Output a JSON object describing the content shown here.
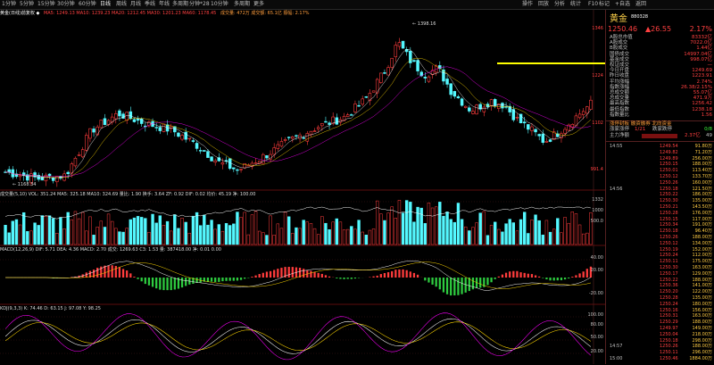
{
  "toolbar": {
    "tabs": [
      "1分钟",
      "5分钟",
      "15分钟",
      "30分钟",
      "60分钟",
      "日线",
      "周线",
      "月线",
      "季线",
      "年线",
      "多周期",
      "分钟*28",
      "10分钟",
      "多周期",
      "更多"
    ],
    "active_tab": "日线",
    "right_items": [
      "操作",
      "回放",
      "分析",
      "统计",
      "F10",
      "标记",
      "+自选",
      "返回"
    ]
  },
  "info": {
    "main": "黄金(日线)前复权 ◆",
    "main_ma": "MA5: 1249.13  MA10: 1239.23  MA20: 1212.45  MA30: 1201.23  MA60: 1178.45",
    "main_extra": "成交量: 472万  成交额: 65.1亿  振幅: 2.17%",
    "vol": "成交量(5,10)  VOL: 351.24  MA5: 325.18  MA10: 324.69  量比: 1.90  换手: 3.64  ZF: 0.92  DIF: 0.02  均价: 45.19  净: 100.00",
    "macd": "MACD(12,26,9)  DIF: 5.71  DEA: 4.36  MACD: 2.70  成交: 1269.63  C3: 1.53  量: 387418.00  净: 0.01  0.00",
    "kdj": "KDJ(9,3,3)  K: 74.46  D: 63.15  J: 97.08  Y: 98.25"
  },
  "price_axis": [
    "1346",
    "1224",
    "1102",
    "991.4"
  ],
  "vol_axis": [
    "1332",
    "1000",
    "500.0"
  ],
  "macd_axis": [
    "40.00",
    "20.00",
    "-20.00"
  ],
  "kdj_axis": [
    "100.00",
    "80.00",
    "50.00",
    "20.00"
  ],
  "annotations": {
    "high": "1398.16",
    "low": "1168.34"
  },
  "sidebar": {
    "title": "黄金",
    "code": "880328",
    "price": "1250.46",
    "change": "▲26.55",
    "change_pct": "2.17%",
    "rows": [
      {
        "label": "A股总市值",
        "value": "83332亿"
      },
      {
        "label": "A股成交",
        "value": "7022.0亿"
      },
      {
        "label": "B股成交",
        "value": "1.44亿"
      },
      {
        "label": "国债成交",
        "value": "14997.04亿"
      },
      {
        "label": "基金成交",
        "value": "998.07亿"
      },
      {
        "label": "权证成交",
        "value": "—"
      },
      {
        "label": "今日开盘",
        "value": "1249.69"
      },
      {
        "label": "昨日收盘",
        "value": "1223.91"
      },
      {
        "label": "平均涨幅",
        "value": "2.74%"
      },
      {
        "label": "指数涨幅",
        "value": "26.38/2.15%"
      },
      {
        "label": "总成交额",
        "value": "55.07亿"
      },
      {
        "label": "总成交量",
        "value": "471.9万"
      },
      {
        "label": "最高指数",
        "value": "1256.42"
      },
      {
        "label": "最低指数",
        "value": "1238.18"
      },
      {
        "label": "指数量比",
        "value": "1.56"
      }
    ],
    "flow_header": "涨停封板  融资融券  北向资金",
    "flow_row1": [
      "涨家涨停",
      "1/21",
      "跌家跌停",
      "0/8"
    ],
    "flow_row2": [
      "主力净额",
      "2.37亿",
      "49"
    ],
    "ticks": [
      {
        "time": "14:55",
        "price": "1249.54",
        "vol": "91.80万"
      },
      {
        "time": "",
        "price": "1249.82",
        "vol": "71.20万"
      },
      {
        "time": "",
        "price": "1249.89",
        "vol": "256.00万"
      },
      {
        "time": "",
        "price": "1250.15",
        "vol": "188.00万"
      },
      {
        "time": "",
        "price": "1250.01",
        "vol": "113.40万"
      },
      {
        "time": "",
        "price": "1250.12",
        "vol": "133.70万"
      },
      {
        "time": "",
        "price": "1250.26",
        "vol": "160.00万"
      },
      {
        "time": "14:56",
        "price": "1250.18",
        "vol": "121.50万"
      },
      {
        "time": "",
        "price": "1250.22",
        "vol": "186.00万"
      },
      {
        "time": "",
        "price": "1250.30",
        "vol": "135.00万"
      },
      {
        "time": "",
        "price": "1250.21",
        "vol": "143.50万"
      },
      {
        "time": "",
        "price": "1250.28",
        "vol": "176.00万"
      },
      {
        "time": "",
        "price": "1250.15",
        "vol": "117.00万"
      },
      {
        "time": "",
        "price": "1250.34",
        "vol": "191.00万"
      },
      {
        "time": "",
        "price": "1250.18",
        "vol": "96.40万"
      },
      {
        "time": "",
        "price": "1250.26",
        "vol": "188.00万"
      },
      {
        "time": "",
        "price": "1250.12",
        "vol": "134.00万"
      },
      {
        "time": "",
        "price": "1250.19",
        "vol": "152.00万"
      },
      {
        "time": "",
        "price": "1250.24",
        "vol": "112.00万"
      },
      {
        "time": "",
        "price": "1250.11",
        "vol": "175.00万"
      },
      {
        "time": "",
        "price": "1250.30",
        "vol": "163.00万"
      },
      {
        "time": "",
        "price": "1250.17",
        "vol": "129.00万"
      },
      {
        "time": "",
        "price": "1250.22",
        "vol": "188.00万"
      },
      {
        "time": "",
        "price": "1250.36",
        "vol": "141.00万"
      },
      {
        "time": "",
        "price": "1250.20",
        "vol": "122.00万"
      },
      {
        "time": "",
        "price": "1250.28",
        "vol": "135.00万"
      },
      {
        "time": "",
        "price": "1250.24",
        "vol": "180.00万"
      },
      {
        "time": "",
        "price": "1250.16",
        "vol": "156.00万"
      },
      {
        "time": "",
        "price": "1250.31",
        "vol": "163.00万"
      },
      {
        "time": "",
        "price": "1250.29",
        "vol": "188.00万"
      },
      {
        "time": "",
        "price": "1249.97",
        "vol": "149.00万"
      },
      {
        "time": "",
        "price": "1250.04",
        "vol": "218.00万"
      },
      {
        "time": "",
        "price": "1250.18",
        "vol": "298.00万"
      },
      {
        "time": "14:57",
        "price": "1250.26",
        "vol": "188.00万"
      },
      {
        "time": "",
        "price": "1250.11",
        "vol": "296.00万"
      },
      {
        "time": "15:00",
        "price": "1250.46",
        "vol": "1884.00万"
      }
    ]
  },
  "colors": {
    "up": "#ff3c3c",
    "down": "#54f8ff",
    "ma5": "#ffffff",
    "ma10": "#ffd700",
    "ma20": "#ff00ff",
    "line": "#ffff00"
  }
}
